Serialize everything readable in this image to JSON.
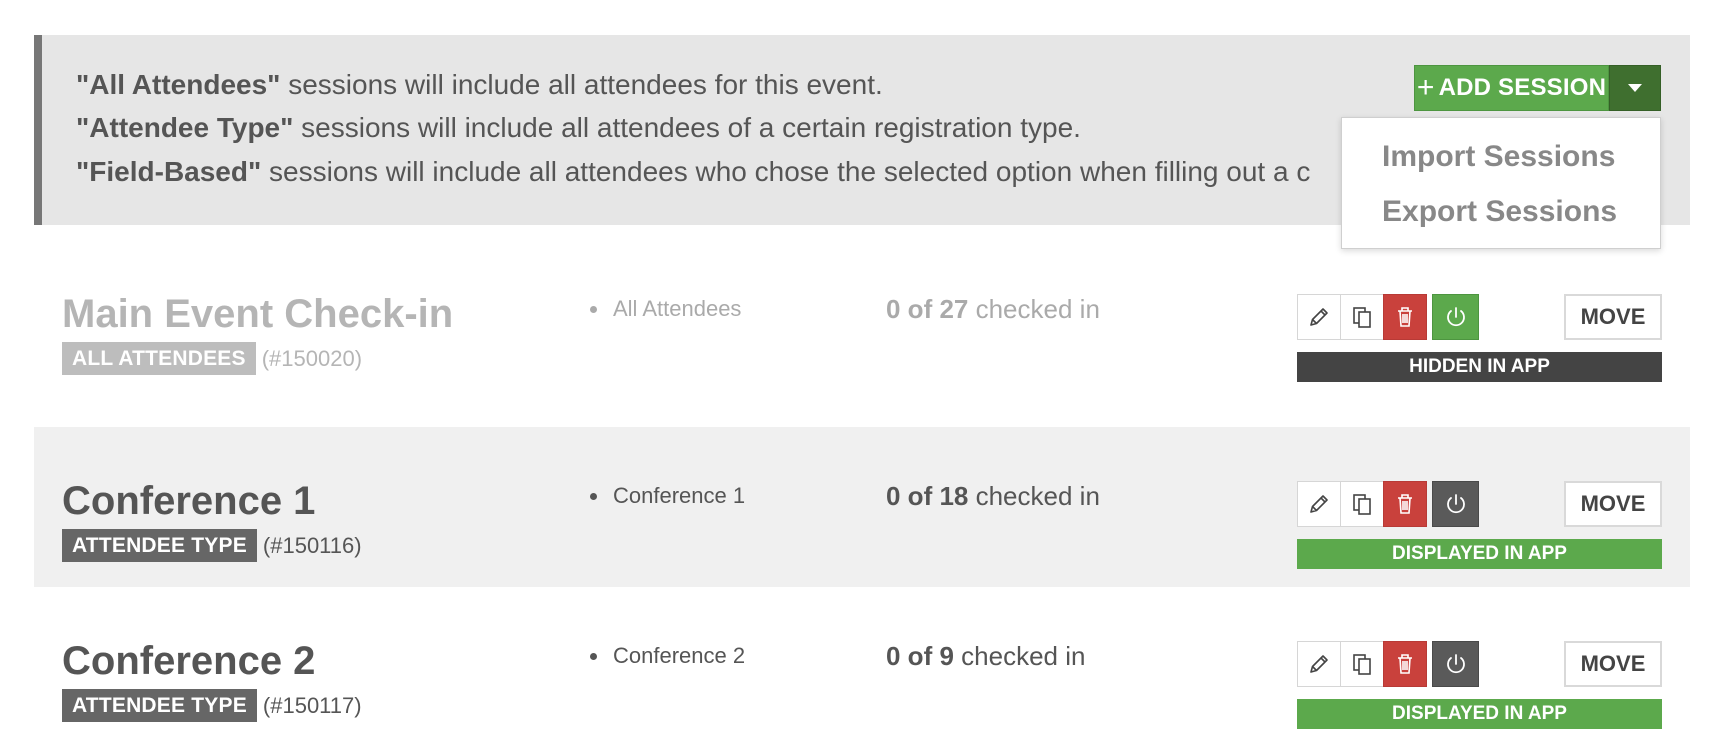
{
  "info": {
    "line1_bold": "\"All Attendees\"",
    "line1_text": " sessions will include all attendees for this event.",
    "line2_bold": "\"Attendee Type\"",
    "line2_text": " sessions will include all attendees of a certain registration type.",
    "line3_bold": "\"Field-Based\"",
    "line3_text": " sessions will include all attendees who chose the selected option when filling out a c"
  },
  "add_session": {
    "label": "ADD SESSION",
    "plus": "+",
    "menu": [
      "Import Sessions",
      "Export Sessions"
    ]
  },
  "colors": {
    "accent_green": "#5ca94c",
    "dark_green": "#3f6f2f",
    "delete_red": "#c9413c",
    "hidden_bar": "#444444"
  },
  "sessions": [
    {
      "title": "Main Event Check-in",
      "type_badge": "ALL ATTENDEES",
      "id": "(#150020)",
      "criteria": "All Attendees",
      "checked_bold": "0 of 27",
      "checked_text": " checked in",
      "power_icon": "power-icon",
      "move_label": "MOVE",
      "status": "HIDDEN IN APP"
    },
    {
      "title": "Conference 1",
      "type_badge": "ATTENDEE TYPE",
      "id": "(#150116)",
      "criteria": "Conference 1",
      "checked_bold": "0 of 18",
      "checked_text": " checked in",
      "power_icon": "power-icon",
      "move_label": "MOVE",
      "status": "DISPLAYED IN APP"
    },
    {
      "title": "Conference 2",
      "type_badge": "ATTENDEE TYPE",
      "id": "(#150117)",
      "criteria": "Conference 2",
      "checked_bold": "0 of 9",
      "checked_text": " checked in",
      "power_icon": "power-icon",
      "move_label": "MOVE",
      "status": "DISPLAYED IN APP"
    }
  ]
}
